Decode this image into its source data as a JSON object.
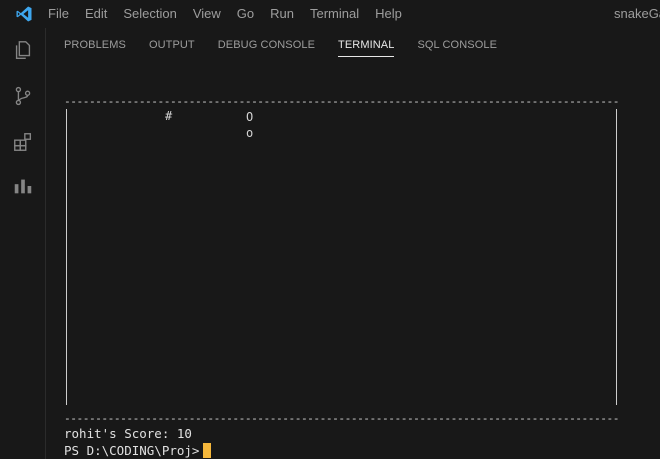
{
  "titlebar": {
    "menu": [
      "File",
      "Edit",
      "Selection",
      "View",
      "Go",
      "Run",
      "Terminal",
      "Help"
    ],
    "window_title": "snakeGar"
  },
  "activitybar": {
    "icons": [
      "explorer-icon",
      "source-control-icon",
      "extensions-icon",
      "charts-icon"
    ]
  },
  "panel": {
    "tabs": [
      "PROBLEMS",
      "OUTPUT",
      "DEBUG CONSOLE",
      "TERMINAL",
      "SQL CONSOLE"
    ],
    "active_tab": "TERMINAL"
  },
  "terminal": {
    "board": {
      "food": "#",
      "snake_head": "O",
      "snake_body": "o"
    },
    "score_line": "rohit's Score: 10",
    "prompt": "PS D:\\CODING\\Proj>"
  },
  "colors": {
    "background": "#181818",
    "cursor": "#f5b73b",
    "logo": "#3ea7ef"
  }
}
